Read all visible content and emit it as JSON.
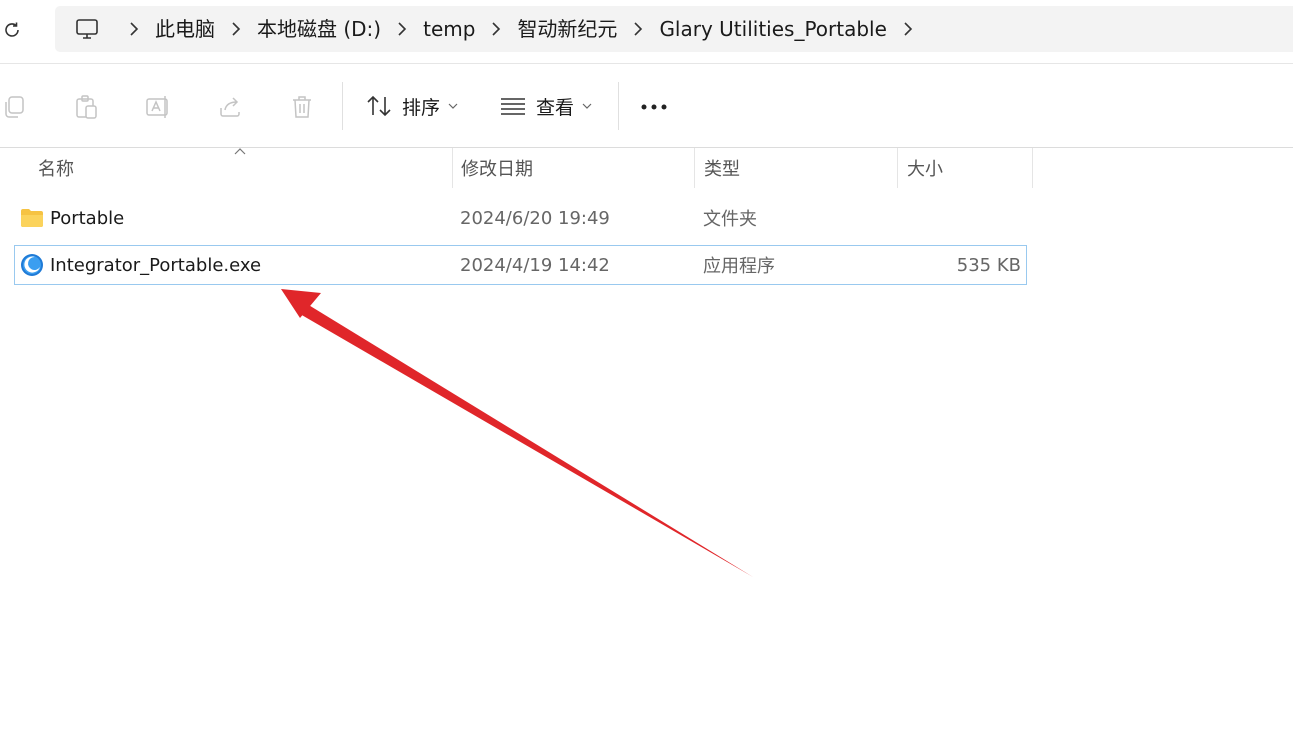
{
  "breadcrumb": {
    "items": [
      "此电脑",
      "本地磁盘 (D:)",
      "temp",
      "智动新纪元",
      "Glary Utilities_Portable"
    ]
  },
  "toolbar": {
    "sort_label": "排序",
    "view_label": "查看"
  },
  "columns": {
    "name": "名称",
    "date": "修改日期",
    "type": "类型",
    "size": "大小"
  },
  "files": [
    {
      "name": "Portable",
      "date": "2024/6/20 19:49",
      "type": "文件夹",
      "size": "",
      "icon": "folder-icon"
    },
    {
      "name": "Integrator_Portable.exe",
      "date": "2024/4/19 14:42",
      "type": "应用程序",
      "size": "535 KB",
      "icon": "app-icon"
    }
  ],
  "colors": {
    "selection_border": "#99c9ef",
    "annotation_arrow": "#e0262a",
    "folder": "#f6c343"
  }
}
